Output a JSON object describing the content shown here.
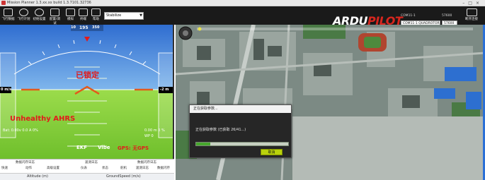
{
  "window": {
    "title": "Mission Planner 1.3.xx.xx build 1.3.7101.32736"
  },
  "toolbar": {
    "buttons": [
      {
        "label": "飞行数据",
        "icon": "flight-data-icon"
      },
      {
        "label": "飞行计划",
        "icon": "flight-plan-icon"
      },
      {
        "label": "初始设置",
        "icon": "initial-setup-icon"
      },
      {
        "label": "配置/调试",
        "icon": "config-tuning-icon"
      },
      {
        "label": "模拟",
        "icon": "simulation-icon"
      },
      {
        "label": "终端",
        "icon": "terminal-icon"
      },
      {
        "label": "帮助",
        "icon": "help-icon"
      }
    ],
    "vehicle_select": "Stabilize",
    "logo_main": "ARDU",
    "logo_accent": "PILOT",
    "com_label": "COM11-1",
    "baud_label": "57600",
    "vehicle_type": "COM11-1 QUADROTOR",
    "disconnect_label": "断开连接"
  },
  "hud": {
    "status_locked": "已锁定",
    "status_ahrs": "Unhealthy AHRS",
    "heading_ticks": [
      "10",
      "0",
      "350"
    ],
    "heading_value": "195",
    "alt_value": "-2 m",
    "speed_value": "0 m/s",
    "gps_status": "GPS: 无GPS",
    "ekf_label": "EKF",
    "vibe_label": "Vibe",
    "battery_left": "Bat: 0.00v 0.0 A 0%",
    "battery_right": "0.00 m 0 %",
    "wp_info": "WP 0",
    "colors": {
      "sky": "#3a7fd8",
      "ground": "#8fd443",
      "warning": "#e21b1b",
      "horizon_marker": "#e35b1b"
    }
  },
  "bottom_panel": {
    "tabs": [
      "快速",
      "动作",
      "舵机/输出",
      "脚本",
      "消息",
      "数据闪存日志",
      "遥测日志",
      "数据闪存日志"
    ],
    "sub_labels": [
      "快速",
      "动作",
      "高级设置",
      "仪表",
      "状态",
      "舵机",
      "遥测日志",
      "数据闪存"
    ],
    "quick_left": "Altitude (m)",
    "quick_right": "GroundSpeed (m/s)"
  },
  "map": {
    "dialog": {
      "title": "正在获取参数...",
      "message": "正在获取参数 (已获取 26/41...)",
      "progress": 0.15,
      "ok_label": "取消"
    }
  }
}
